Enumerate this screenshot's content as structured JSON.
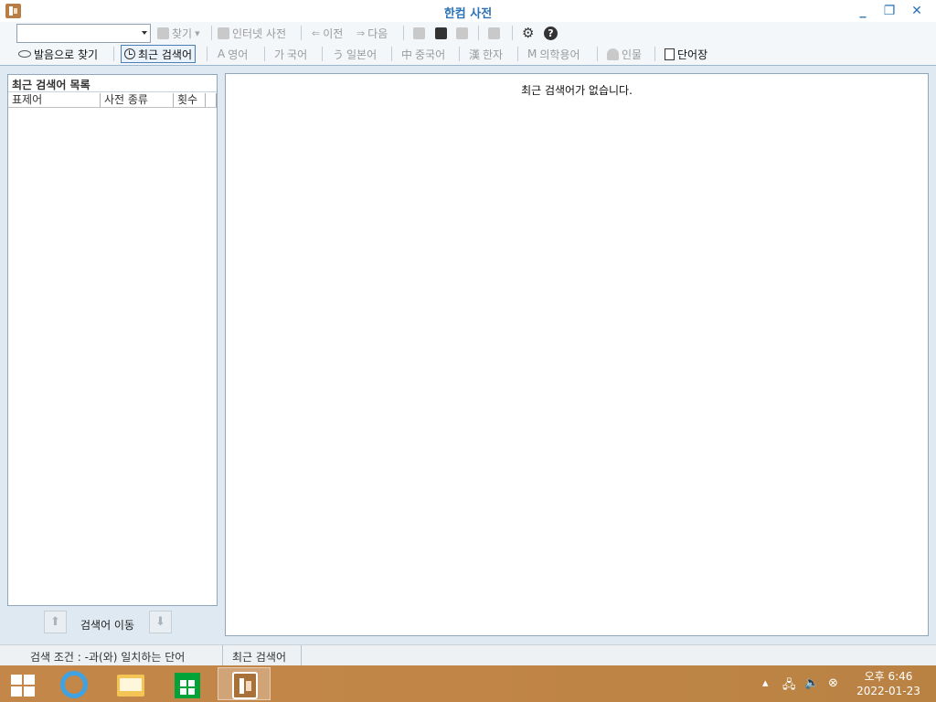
{
  "window": {
    "title": "한컴 사전",
    "minimize_symbol": "_",
    "restore_symbol": "❐",
    "close_symbol": "✕"
  },
  "toolbar": {
    "search_value": "",
    "find": "찾기",
    "internet_dict": "인터넷 사전",
    "prev": "이전",
    "next": "다음",
    "find_by_pronunciation": "발음으로 찾기",
    "recent_searches": "최근 검색어",
    "english": "영어",
    "korean": "국어",
    "japanese": "일본어",
    "chinese": "중국어",
    "hanja": "한자",
    "medical": "의학용어",
    "people": "인물",
    "wordbook": "단어장",
    "icons": {
      "english": "A",
      "korean": "가",
      "japanese": "う",
      "chinese": "中",
      "hanja": "漢",
      "medical": "M"
    }
  },
  "left_panel": {
    "title": "최근 검색어 목록",
    "columns": [
      "표제어",
      "사전 종류",
      "횟수"
    ],
    "move_label": "검색어 이동"
  },
  "right_panel": {
    "empty_message": "최근 검색어가 없습니다."
  },
  "status_bar": {
    "search_condition": "검색 조건 : -과(와) 일치하는 단어",
    "mode": "최근 검색어"
  },
  "taskbar": {
    "time": "오후 6:46",
    "date": "2022-01-23"
  }
}
